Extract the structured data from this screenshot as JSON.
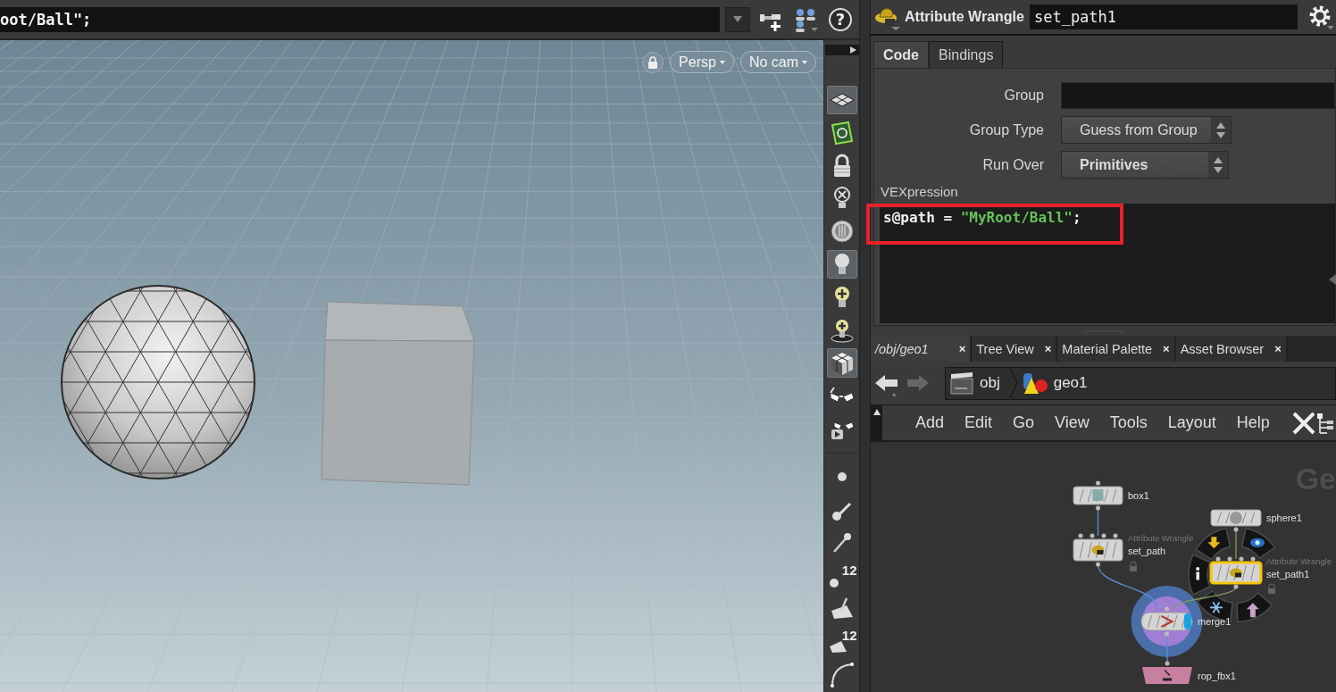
{
  "command_field": {
    "value": "oot/Ball\";"
  },
  "top_tools": [
    {
      "kind": "pin"
    },
    {
      "kind": "people"
    }
  ],
  "help_button": "?",
  "viewport": {
    "view_menus": [
      "Persp",
      "No cam"
    ]
  },
  "viewport_tools": [
    {
      "kind": "grid",
      "selected": true
    },
    {
      "kind": "snap",
      "selected": false
    },
    {
      "kind": "lock",
      "selected": false
    },
    {
      "kind": "bulb-x",
      "selected": false
    },
    {
      "kind": "dial",
      "selected": false
    },
    {
      "kind": "bulb",
      "selected": true
    },
    {
      "kind": "bulb-plus",
      "selected": false
    },
    {
      "kind": "bulb-target",
      "selected": false
    },
    {
      "kind": "cube",
      "selected": true
    },
    {
      "kind": "glasses",
      "selected": false
    },
    {
      "kind": "glasses-play",
      "selected": false
    }
  ],
  "display_tools": [
    {
      "kind": "point"
    },
    {
      "kind": "line-point"
    },
    {
      "kind": "needle"
    },
    {
      "kind": "point-number",
      "label": "12"
    },
    {
      "kind": "face"
    },
    {
      "kind": "face-number",
      "label": "12"
    },
    {
      "kind": "curve"
    }
  ],
  "parameters": {
    "node_type": "Attribute Wrangle",
    "node_name": "set_path1",
    "tabs": [
      {
        "label": "Code",
        "selected": true
      },
      {
        "label": "Bindings",
        "selected": false
      }
    ],
    "fields": [
      {
        "label": "Group",
        "kind": "text"
      },
      {
        "label": "Group Type",
        "kind": "menu",
        "value": "Guess from Group",
        "modified": false
      },
      {
        "label": "Run Over",
        "kind": "menu",
        "value": "Primitives",
        "modified": true
      }
    ],
    "code_label": "VEXpression",
    "code": [
      {
        "text": "s@path = ",
        "kind": "plain"
      },
      {
        "text": "\"MyRoot/Ball\"",
        "kind": "string"
      },
      {
        "text": ";",
        "kind": "plain"
      }
    ]
  },
  "network": {
    "pane_tabs": [
      {
        "label": "/obj/geo1",
        "selected": true,
        "close": "×"
      },
      {
        "label": "Tree View",
        "selected": false,
        "close": "×"
      },
      {
        "label": "Material Palette",
        "selected": false,
        "close": "×"
      },
      {
        "label": "Asset Browser",
        "selected": false,
        "close": "×"
      }
    ],
    "path": [
      "obj",
      "geo1"
    ],
    "menu": [
      "Add",
      "Edit",
      "Go",
      "View",
      "Tools",
      "Layout",
      "Help"
    ],
    "context_label": "Ge",
    "nodes": [
      {
        "name": "box1",
        "kind": "box",
        "selected": false,
        "locked": false,
        "display": false
      },
      {
        "name": "set_path",
        "kind": "wrangle",
        "type_label": "Attribute Wrangle",
        "selected": false,
        "locked": true,
        "display": false
      },
      {
        "name": "sphere1",
        "kind": "sphere",
        "selected": false,
        "locked": false,
        "display": false
      },
      {
        "name": "set_path1",
        "kind": "wrangle",
        "type_label": "Attribute Wrangle",
        "selected": true,
        "locked": true,
        "display": false
      },
      {
        "name": "merge1",
        "kind": "merge",
        "selected": false,
        "locked": false,
        "display": true
      },
      {
        "name": "rop_fbx1",
        "kind": "rop",
        "selected": false,
        "locked": false,
        "display": false
      }
    ]
  }
}
